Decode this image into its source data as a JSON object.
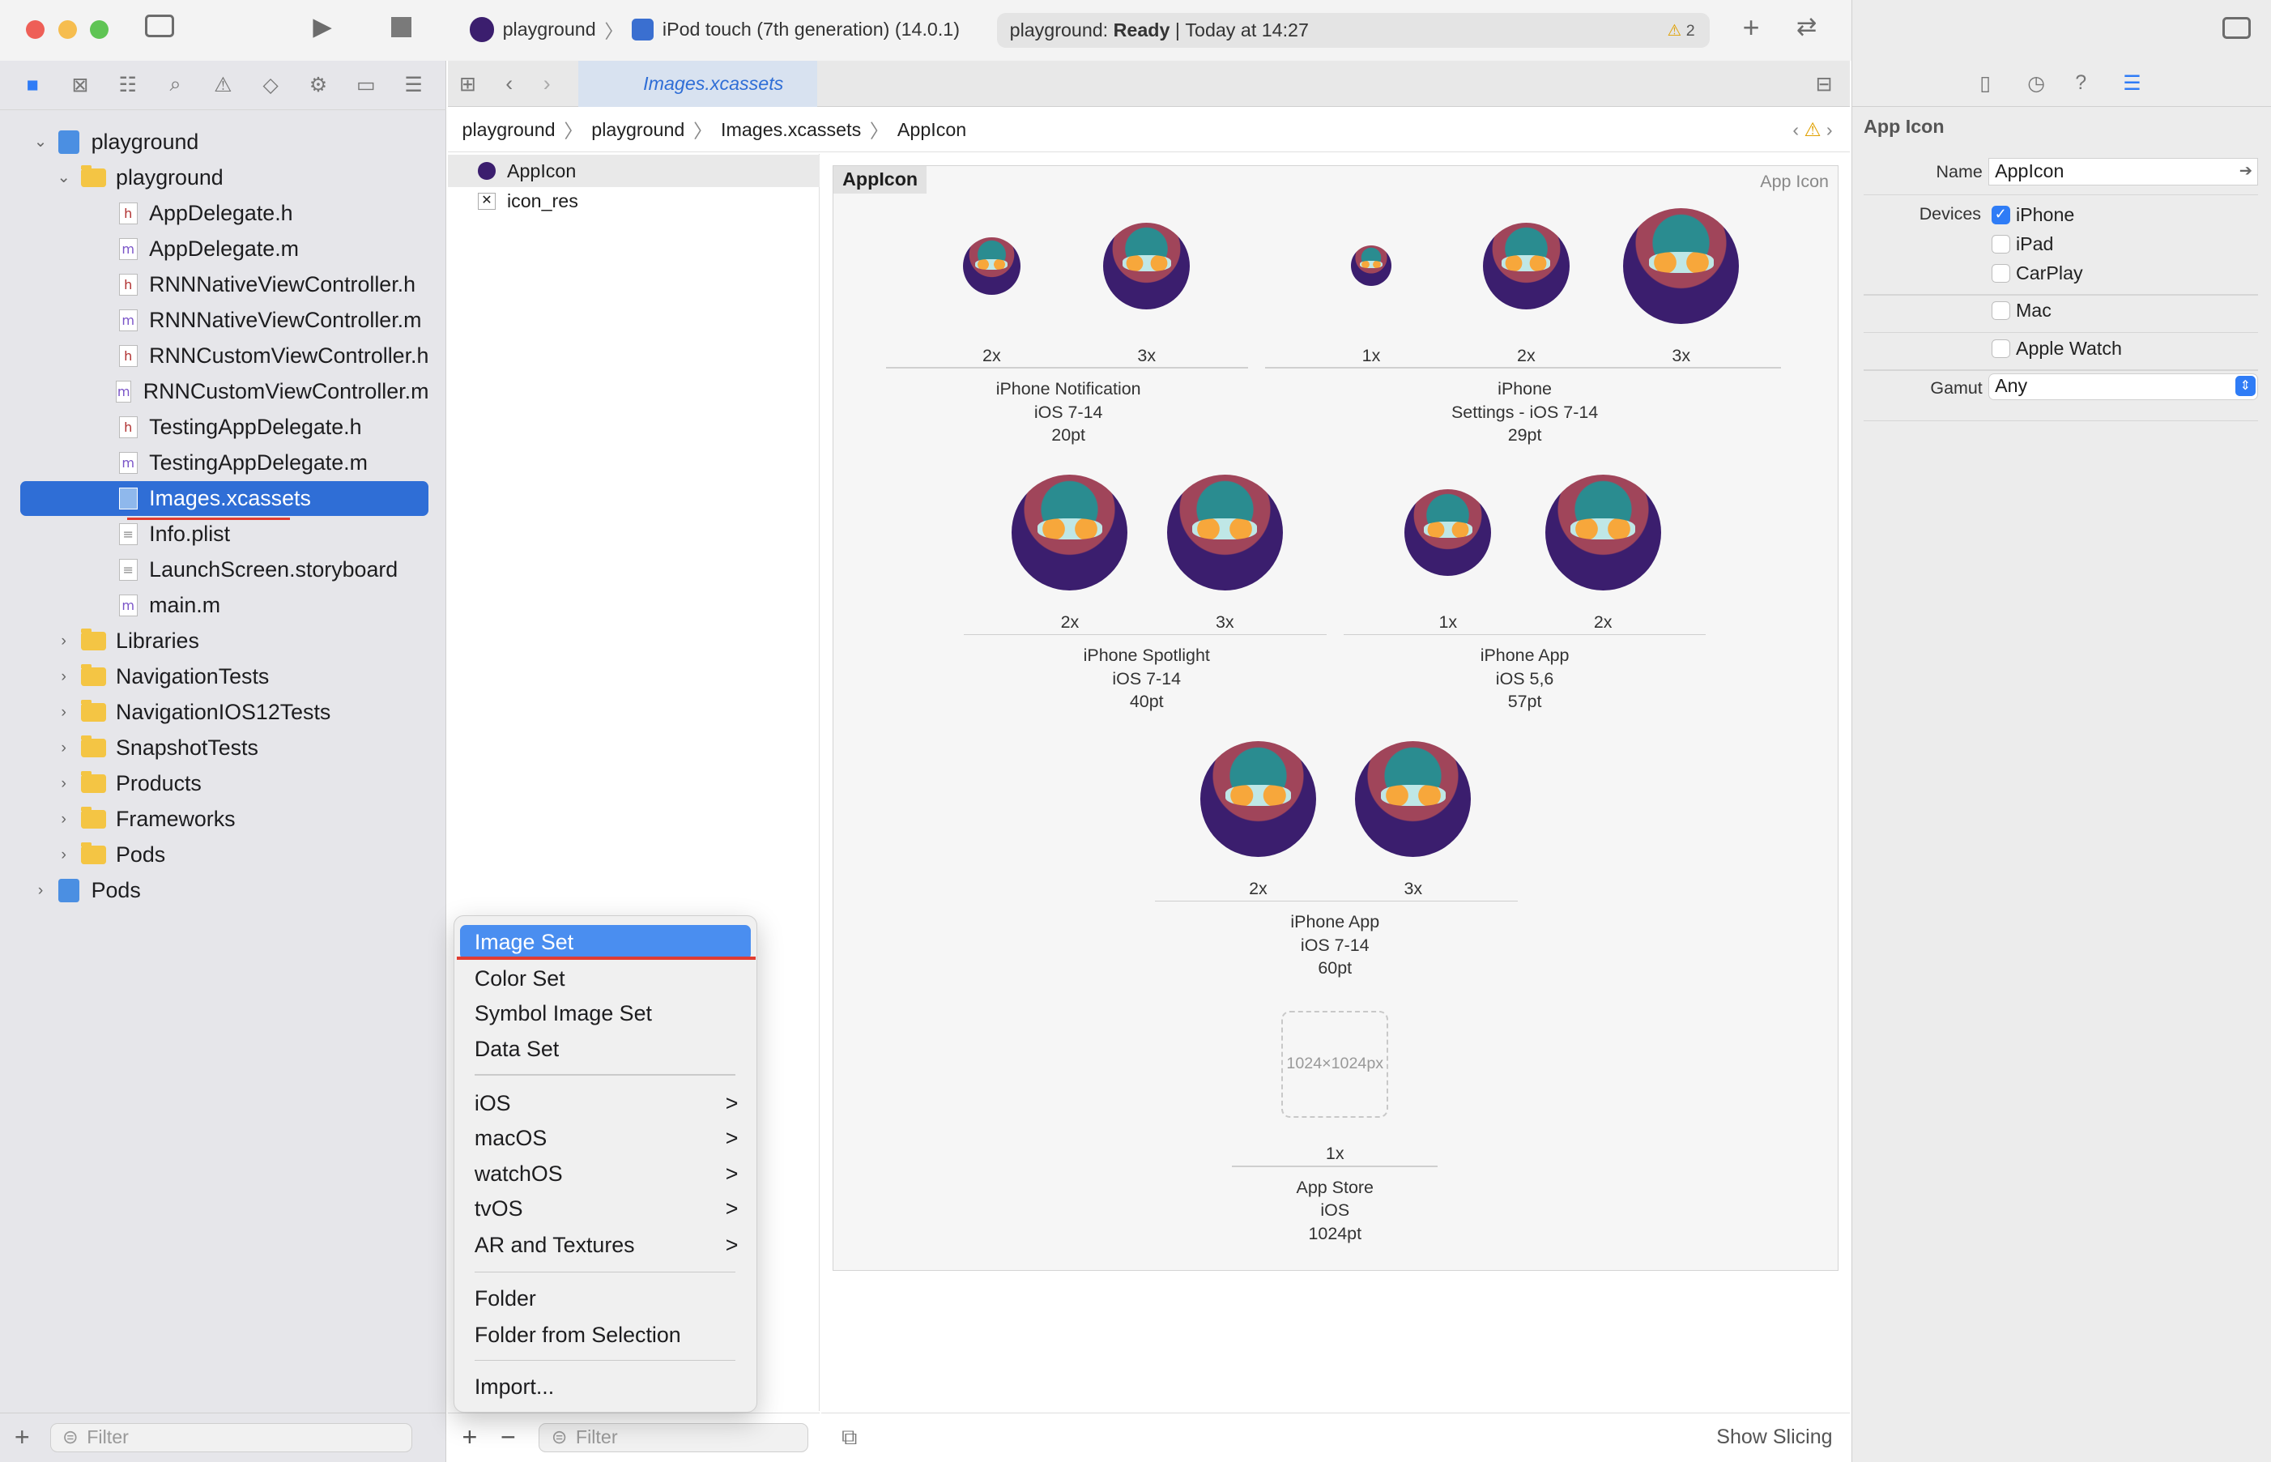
{
  "toolbar": {
    "scheme": "playground",
    "device": "iPod touch (7th generation) (14.0.1)",
    "status_project": "playground:",
    "status_state": "Ready",
    "status_time": "Today at 14:27",
    "warning_count": "2"
  },
  "navigator": {
    "items": [
      {
        "label": "playground",
        "kind": "project",
        "level": 0,
        "disclosure": "v"
      },
      {
        "label": "playground",
        "kind": "folder",
        "level": 1,
        "disclosure": "v"
      },
      {
        "label": "AppDelegate.h",
        "kind": "h",
        "level": 2
      },
      {
        "label": "AppDelegate.m",
        "kind": "m",
        "level": 2
      },
      {
        "label": "RNNNativeViewController.h",
        "kind": "h",
        "level": 2
      },
      {
        "label": "RNNNativeViewController.m",
        "kind": "m",
        "level": 2
      },
      {
        "label": "RNNCustomViewController.h",
        "kind": "h",
        "level": 2
      },
      {
        "label": "RNNCustomViewController.m",
        "kind": "m",
        "level": 2
      },
      {
        "label": "TestingAppDelegate.h",
        "kind": "h",
        "level": 2
      },
      {
        "label": "TestingAppDelegate.m",
        "kind": "m",
        "level": 2
      },
      {
        "label": "Images.xcassets",
        "kind": "assets",
        "level": 2,
        "selected": true
      },
      {
        "label": "Info.plist",
        "kind": "plain",
        "level": 2
      },
      {
        "label": "LaunchScreen.storyboard",
        "kind": "plain",
        "level": 2
      },
      {
        "label": "main.m",
        "kind": "m",
        "level": 2
      },
      {
        "label": "Libraries",
        "kind": "folder",
        "level": 1,
        "disclosure": ">"
      },
      {
        "label": "NavigationTests",
        "kind": "folder",
        "level": 1,
        "disclosure": ">"
      },
      {
        "label": "NavigationIOS12Tests",
        "kind": "folder",
        "level": 1,
        "disclosure": ">"
      },
      {
        "label": "SnapshotTests",
        "kind": "folder",
        "level": 1,
        "disclosure": ">"
      },
      {
        "label": "Products",
        "kind": "folder",
        "level": 1,
        "disclosure": ">"
      },
      {
        "label": "Frameworks",
        "kind": "folder",
        "level": 1,
        "disclosure": ">"
      },
      {
        "label": "Pods",
        "kind": "folder",
        "level": 1,
        "disclosure": ">"
      },
      {
        "label": "Pods",
        "kind": "project",
        "level": 0,
        "disclosure": ">"
      }
    ],
    "filter_placeholder": "Filter"
  },
  "editor": {
    "tab_label": "Images.xcassets",
    "breadcrumb": [
      "playground",
      "playground",
      "Images.xcassets",
      "AppIcon"
    ],
    "asset_list": [
      "AppIcon",
      "icon_res"
    ],
    "asset_filter_placeholder": "Filter",
    "panel_title": "AppIcon",
    "panel_kind": "App Icon",
    "slots": [
      {
        "scale": "2x",
        "size": "s"
      },
      {
        "scale": "3x",
        "size": "m"
      },
      {
        "scale": "1x",
        "size": "xs"
      },
      {
        "scale": "2x",
        "size": "m"
      },
      {
        "scale": "3x",
        "size": "l"
      },
      {
        "scale": "2x",
        "size": "l"
      },
      {
        "scale": "3x",
        "size": "l"
      },
      {
        "scale": "1x",
        "size": "m"
      },
      {
        "scale": "2x",
        "size": "l"
      },
      {
        "scale": "2x",
        "size": "l"
      },
      {
        "scale": "3x",
        "size": "l"
      },
      {
        "scale": "1x",
        "size": "empty"
      }
    ],
    "groups": [
      {
        "line1": "iPhone Notification",
        "line2": "iOS 7-14",
        "line3": "20pt"
      },
      {
        "line1": "iPhone",
        "line2": "Settings - iOS 7-14",
        "line3": "29pt"
      },
      {
        "line1": "iPhone Spotlight",
        "line2": "iOS 7-14",
        "line3": "40pt"
      },
      {
        "line1": "iPhone App",
        "line2": "iOS 5,6",
        "line3": "57pt"
      },
      {
        "line1": "iPhone App",
        "line2": "iOS 7-14",
        "line3": "60pt"
      },
      {
        "line1": "App Store",
        "line2": "iOS",
        "line3": "1024pt"
      }
    ],
    "placeholder_size": "1024×1024px",
    "show_slicing": "Show Slicing"
  },
  "menu": {
    "items": [
      "Image Set",
      "Color Set",
      "Symbol Image Set",
      "Data Set",
      "iOS",
      "macOS",
      "watchOS",
      "tvOS",
      "AR and Textures",
      "Folder",
      "Folder from Selection",
      "Import..."
    ],
    "submenu_arrow": ">"
  },
  "inspector": {
    "section_title": "App Icon",
    "name_label": "Name",
    "name_value": "AppIcon",
    "devices_label": "Devices",
    "devices": [
      {
        "label": "iPhone",
        "checked": true
      },
      {
        "label": "iPad",
        "checked": false
      },
      {
        "label": "CarPlay",
        "checked": false
      },
      {
        "label": "Mac",
        "checked": false
      },
      {
        "label": "Apple Watch",
        "checked": false
      }
    ],
    "gamut_label": "Gamut",
    "gamut_value": "Any"
  },
  "colors": {
    "accent": "#2f6ed6",
    "menu_highlight": "#4a8ef0",
    "folder": "#f4c544"
  }
}
